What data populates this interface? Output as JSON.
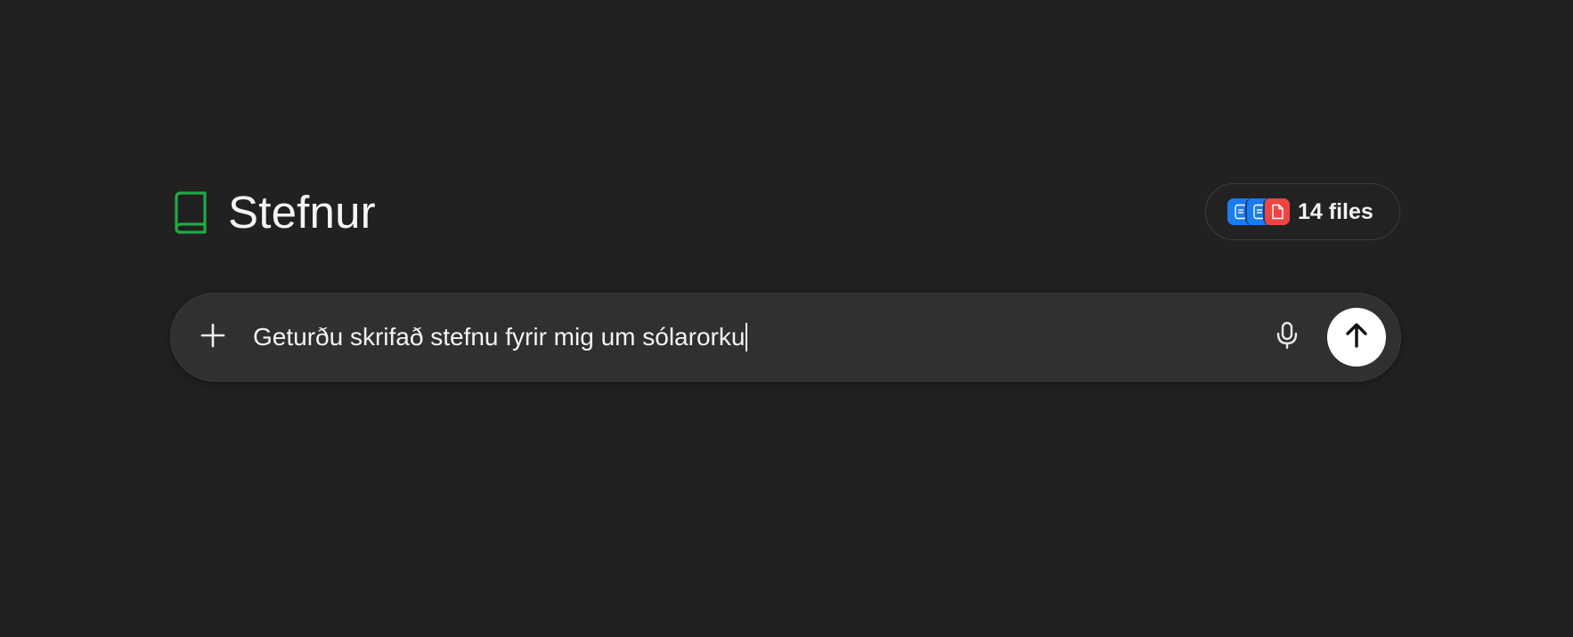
{
  "project": {
    "title": "Stefnur",
    "icon": "book-icon",
    "accent_color": "#22a845"
  },
  "files": {
    "count_label": "14 files",
    "thumbnails": [
      {
        "icon": "document-icon",
        "color": "#1a7cf2"
      },
      {
        "icon": "document-icon",
        "color": "#1a7cf2"
      },
      {
        "icon": "pdf-icon",
        "color": "#ef4444"
      }
    ]
  },
  "composer": {
    "value": "Geturðu skrifað stefnu fyrir mig um sólarorku",
    "plus_icon": "plus-icon",
    "mic_icon": "microphone-icon",
    "send_icon": "arrow-up-icon"
  }
}
